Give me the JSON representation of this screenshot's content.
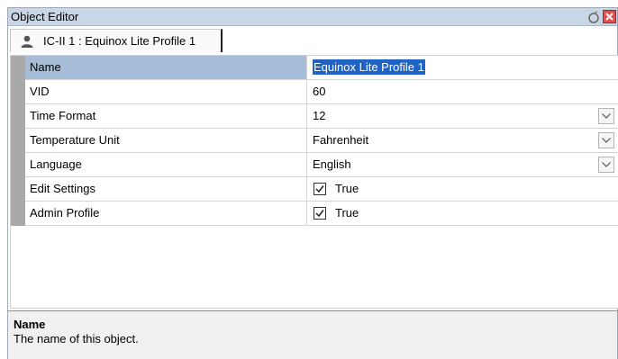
{
  "window": {
    "title": "Object Editor"
  },
  "tab": {
    "label": "IC-II 1 : Equinox Lite Profile 1"
  },
  "properties": [
    {
      "name": "Name",
      "value": "Equinox Lite Profile 1"
    },
    {
      "name": "VID",
      "value": "60"
    },
    {
      "name": "Time Format",
      "value": "12"
    },
    {
      "name": "Temperature Unit",
      "value": "Fahrenheit"
    },
    {
      "name": "Language",
      "value": "English"
    },
    {
      "name": "Edit Settings",
      "value": "True"
    },
    {
      "name": "Admin Profile",
      "value": "True"
    }
  ],
  "description": {
    "title": "Name",
    "text": "The name of this object."
  },
  "colors": {
    "selection": "#1f63c6",
    "selected_row": "#a7bcd6",
    "titlebar": "#c9d6e5"
  }
}
